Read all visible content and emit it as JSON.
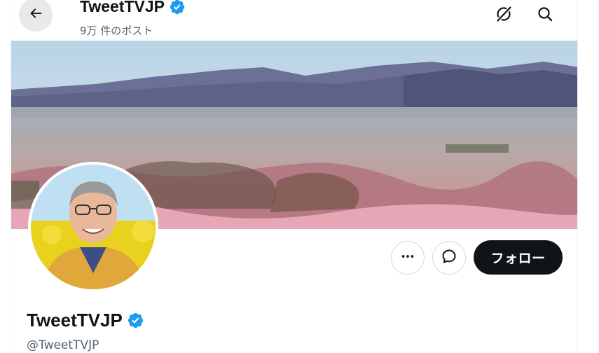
{
  "header": {
    "title": "TweetTVJP",
    "post_count": "9万 件のポスト",
    "back_icon": "arrow-left-icon",
    "grok_icon": "grok-icon",
    "search_icon": "search-icon"
  },
  "banner": {
    "description_icon": "landscape-banner-image"
  },
  "profile": {
    "display_name": "TweetTVJP",
    "handle": "@TweetTVJP",
    "verified": true
  },
  "actions": {
    "follow_label": "フォロー",
    "more_icon": "more-icon",
    "message_icon": "message-icon"
  },
  "colors": {
    "verified_blue": "#1d9bf0",
    "primary_text": "#0f1419",
    "secondary_text": "#536471",
    "follow_bg": "#0f1419"
  }
}
